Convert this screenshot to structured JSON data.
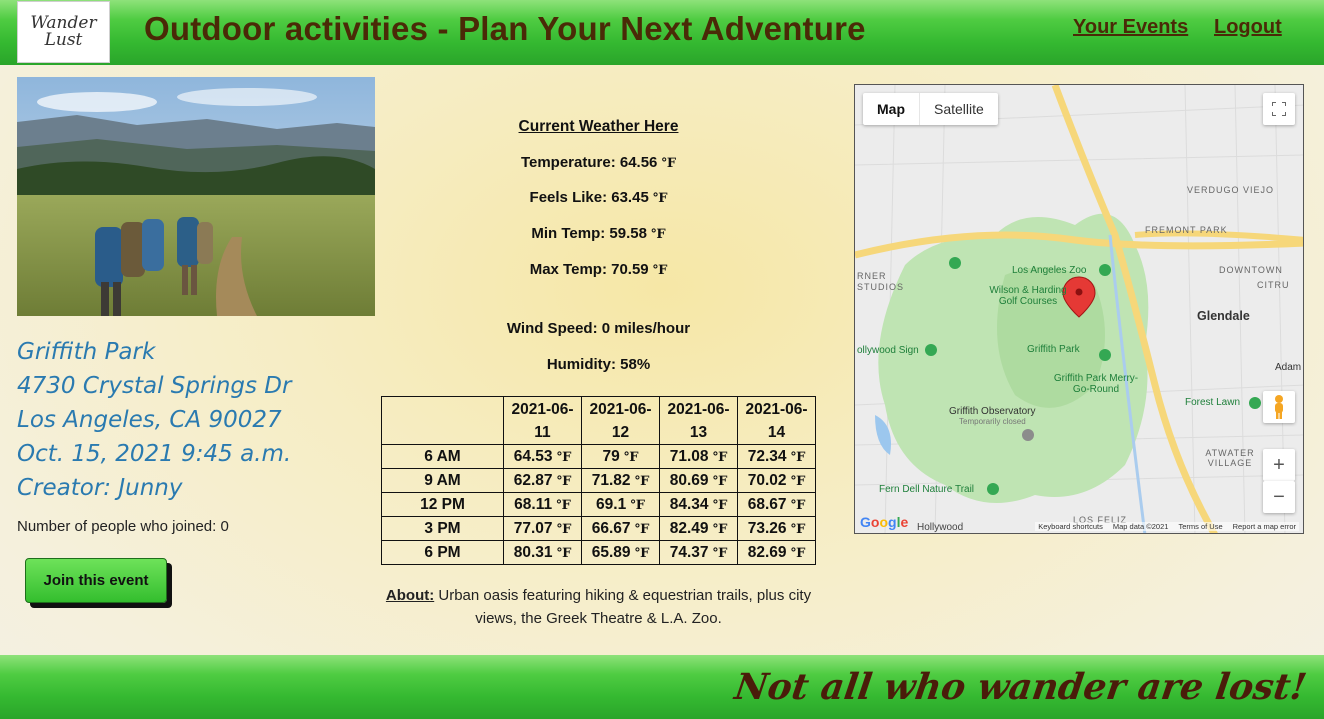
{
  "header": {
    "logo_text": "Wander Lust",
    "title": "Outdoor activities - Plan Your Next Adventure",
    "nav": {
      "events": "Your Events",
      "logout": "Logout"
    }
  },
  "event": {
    "park_name": "Griffith Park",
    "address_line1": "4730 Crystal Springs Dr",
    "address_line2": "Los Angeles, CA 90027",
    "datetime": "Oct. 15, 2021 9:45 a.m.",
    "creator": "Creator: Junny",
    "joined_text": "Number of people who joined: 0",
    "join_button": "Join this event"
  },
  "weather": {
    "heading": "Current Weather Here",
    "temperature": "Temperature: 64.56",
    "feels_like": "Feels Like: 63.45",
    "min_temp": "Min Temp: 59.58",
    "max_temp": "Max Temp: 70.59",
    "wind": "Wind Speed: 0 miles/hour",
    "humidity": "Humidity: 58%",
    "unit": "℉"
  },
  "forecast": {
    "dates": [
      "2021-06-11",
      "2021-06-12",
      "2021-06-13",
      "2021-06-14"
    ],
    "rows": [
      {
        "time": "6 AM",
        "temps": [
          "64.53",
          "79",
          "71.08",
          "72.34"
        ]
      },
      {
        "time": "9 AM",
        "temps": [
          "62.87",
          "71.82",
          "80.69",
          "70.02"
        ]
      },
      {
        "time": "12 PM",
        "temps": [
          "68.11",
          "69.1",
          "84.34",
          "68.67"
        ]
      },
      {
        "time": "3 PM",
        "temps": [
          "77.07",
          "66.67",
          "82.49",
          "73.26"
        ]
      },
      {
        "time": "6 PM",
        "temps": [
          "80.31",
          "65.89",
          "74.37",
          "82.69"
        ]
      }
    ]
  },
  "about": {
    "label": "About:",
    "text": " Urban oasis featuring hiking & equestrian trails, plus city views, the Greek Theatre & L.A. Zoo."
  },
  "map": {
    "type_map": "Map",
    "type_satellite": "Satellite",
    "zoom_in": "+",
    "zoom_out": "−",
    "labels": {
      "zoo": "Los Angeles Zoo",
      "golf": "Wilson & Harding Golf Courses",
      "griffith": "Griffith Park",
      "merry": "Griffith Park Merry-Go-Round",
      "observatory": "Griffith Observatory",
      "observatory_note": "Temporarily closed",
      "fern": "Fern Dell Nature Trail",
      "hollywood_sign": "ollywood Sign",
      "glendale": "Glendale",
      "verdugo": "VERDUGO VIEJO",
      "fremont": "FREMONT PARK",
      "downtown": "DOWNTOWN",
      "citrus": "CITRU",
      "adam": "Adam",
      "forest": "Forest Lawn",
      "atwater": "ATWATER VILLAGE",
      "studios": "RNER STUDIOS",
      "los_feliz": "LOS FELIZ",
      "hollywood": "Hollywood",
      "google": "Google"
    },
    "footer": [
      "Keyboard shortcuts",
      "Map data ©2021",
      "Terms of Use",
      "Report a map error"
    ]
  },
  "footer": {
    "tagline": "Not all who wander are lost!"
  }
}
